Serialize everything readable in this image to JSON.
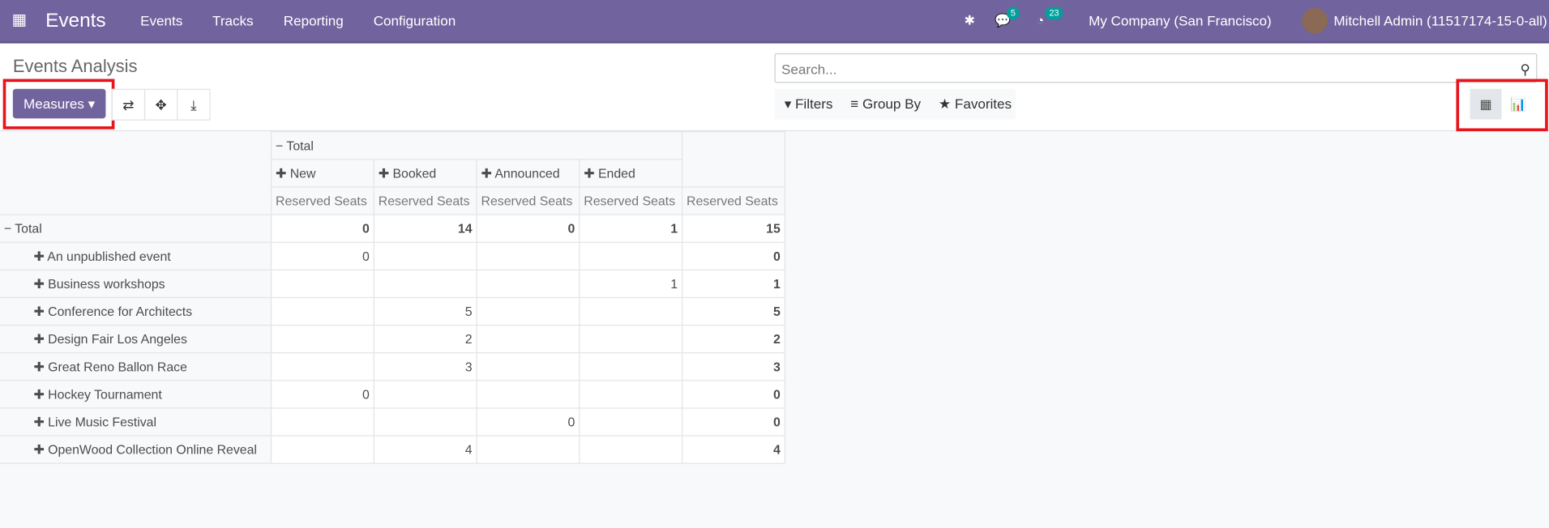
{
  "nav": {
    "app": "Events",
    "menu": [
      "Events",
      "Tracks",
      "Reporting",
      "Configuration"
    ],
    "messages_count": "5",
    "activities_count": "23",
    "company": "My Company (San Francisco)",
    "user": "Mitchell Admin (11517174-15-0-all)"
  },
  "control": {
    "title": "Events Analysis",
    "measures": "Measures",
    "search_placeholder": "Search...",
    "filters": "Filters",
    "group_by": "Group By",
    "favorites": "Favorites"
  },
  "colors": {
    "brand": "#71639e",
    "highlight": "#e8141c",
    "badge": "#00a09d"
  },
  "pivot": {
    "col_total": "Total",
    "columns": [
      "New",
      "Booked",
      "Announced",
      "Ended"
    ],
    "measure": "Reserved Seats",
    "row_total": {
      "label": "Total",
      "values": [
        "0",
        "14",
        "0",
        "1",
        "15"
      ]
    },
    "rows": [
      {
        "label": "An unpublished event",
        "values": [
          "0",
          "",
          "",
          "",
          "0"
        ]
      },
      {
        "label": "Business workshops",
        "values": [
          "",
          "",
          "",
          "1",
          "1"
        ]
      },
      {
        "label": "Conference for Architects",
        "values": [
          "",
          "5",
          "",
          "",
          "5"
        ]
      },
      {
        "label": "Design Fair Los Angeles",
        "values": [
          "",
          "2",
          "",
          "",
          "2"
        ]
      },
      {
        "label": "Great Reno Ballon Race",
        "values": [
          "",
          "3",
          "",
          "",
          "3"
        ]
      },
      {
        "label": "Hockey Tournament",
        "values": [
          "0",
          "",
          "",
          "",
          "0"
        ]
      },
      {
        "label": "Live Music Festival",
        "values": [
          "",
          "",
          "0",
          "",
          "0"
        ]
      },
      {
        "label": "OpenWood Collection Online Reveal",
        "values": [
          "",
          "4",
          "",
          "",
          "4"
        ]
      }
    ]
  }
}
